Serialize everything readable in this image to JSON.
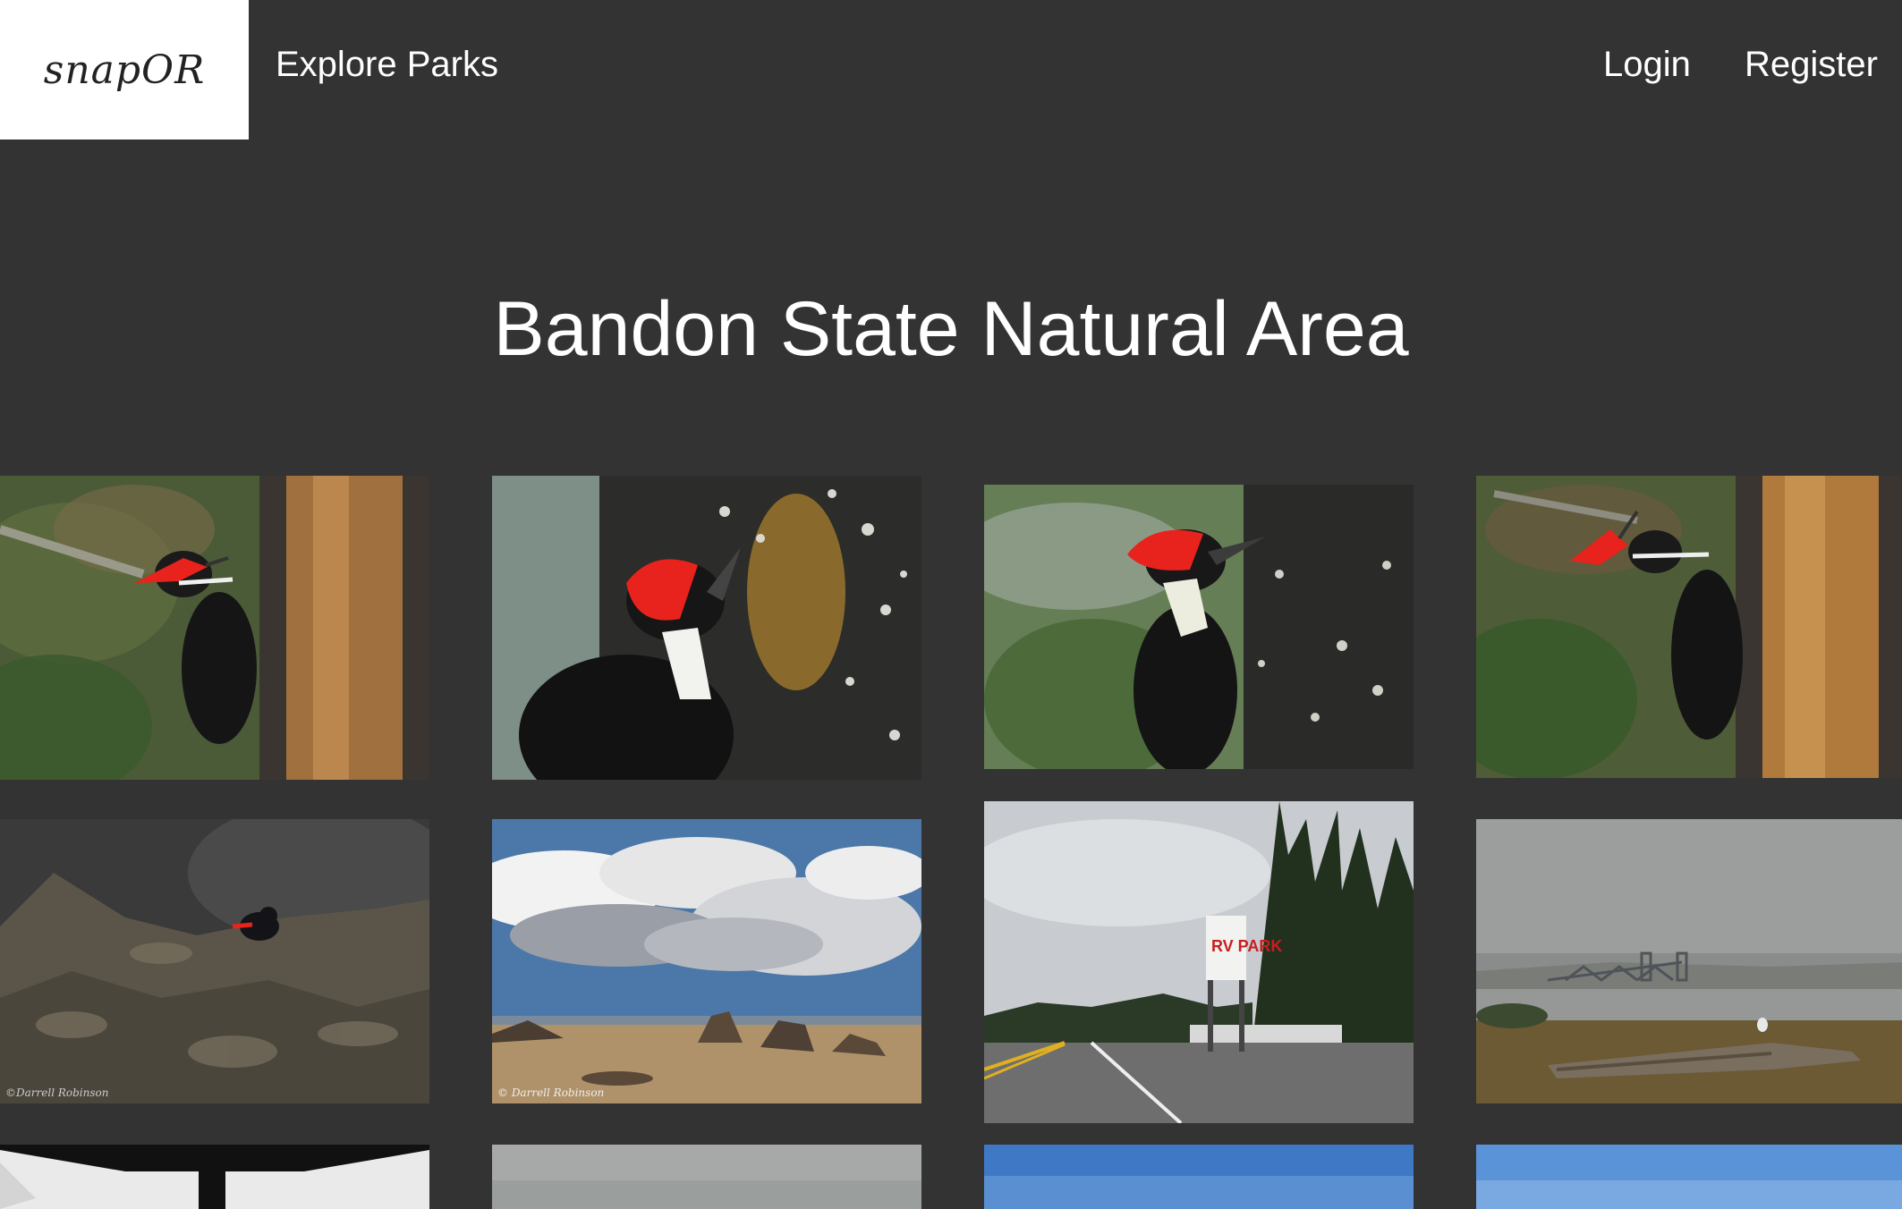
{
  "navbar": {
    "logo_text": "snapOR",
    "explore_label": "Explore Parks",
    "login_label": "Login",
    "register_label": "Register"
  },
  "page_title": "Bandon State Natural Area",
  "photos": [
    {
      "subject": "pileated woodpecker on tree trunk"
    },
    {
      "subject": "pileated woodpecker close-up on bark"
    },
    {
      "subject": "pileated woodpecker on mossy tree"
    },
    {
      "subject": "pileated woodpecker on tree trunk"
    },
    {
      "subject": "black oystercatcher on rocks",
      "credit": "©Darrell Robinson"
    },
    {
      "subject": "clouds over beach sea stacks",
      "credit": "© Darrell Robinson"
    },
    {
      "subject": "road with RV park sign",
      "sign_text": "RV PARK"
    },
    {
      "subject": "foggy bay with bridge and driftwood"
    },
    {
      "subject": "structure against white sky"
    },
    {
      "subject": "gray foggy sky"
    },
    {
      "subject": "blue sky"
    },
    {
      "subject": "blue sky"
    }
  ],
  "colors": {
    "background": "#333333",
    "logo_background": "#ffffff",
    "text": "#ffffff",
    "woodpecker_crest": "#e8221c"
  }
}
